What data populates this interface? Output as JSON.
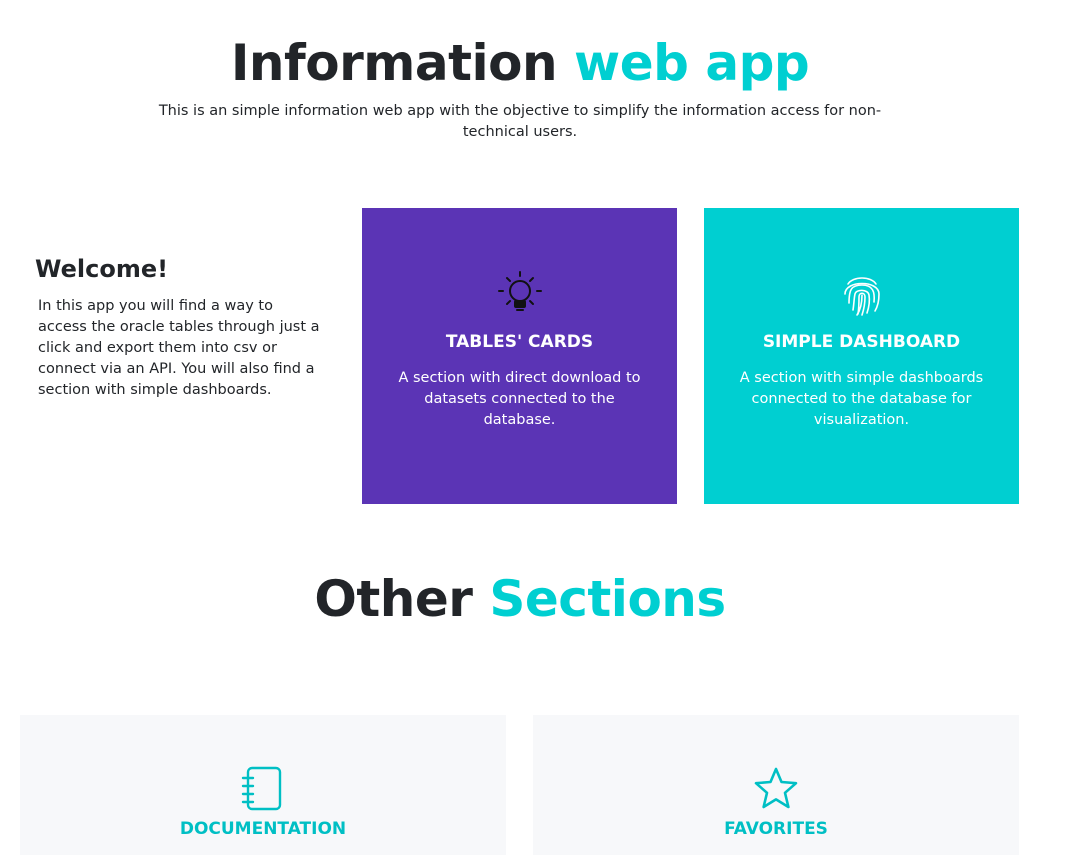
{
  "header": {
    "title_main": "Information",
    "title_accent": "web app",
    "subtitle": "This is an simple information web app with the objective to simplify the information access for non-technical users."
  },
  "welcome": {
    "title": "Welcome!",
    "text": "In this app you will find a way to access the oracle tables through just a click and export them into csv or connect via an API. You will also find a section with simple dashboards."
  },
  "cards": [
    {
      "icon": "lightbulb-icon",
      "title": "TABLES' CARDS",
      "description": "A section with direct download to datasets connected to the database.",
      "color": "#5b34b5"
    },
    {
      "icon": "fingerprint-icon",
      "title": "SIMPLE DASHBOARD",
      "description": "A section with simple dashboards connected to the database for visualization.",
      "color": "#00cfd1"
    }
  ],
  "other_sections": {
    "title_main": "Other",
    "title_accent": "Sections",
    "items": [
      {
        "icon": "notebook-icon",
        "label": "DOCUMENTATION"
      },
      {
        "icon": "star-icon",
        "label": "FAVORITES"
      }
    ]
  },
  "colors": {
    "accent": "#00cfd1",
    "purple": "#5b34b5",
    "text": "#222529",
    "panel": "#f7f8fa"
  }
}
